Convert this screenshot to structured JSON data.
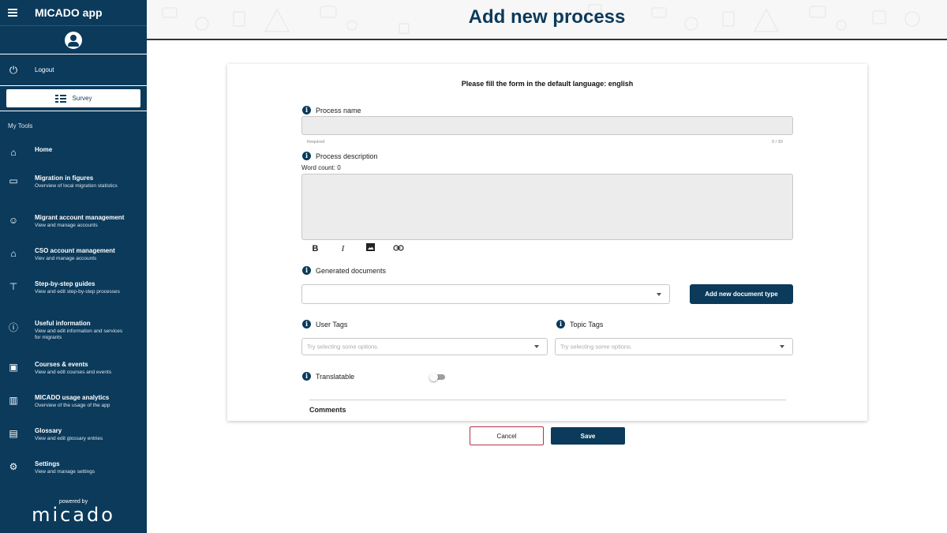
{
  "app": {
    "title": "MICADO app"
  },
  "sidebar": {
    "logout_label": "Logout",
    "survey_label": "Survey",
    "section_title": "My Tools",
    "items": [
      {
        "icon": "home-icon",
        "glyph": "⌂",
        "title": "Home",
        "subtitle": ""
      },
      {
        "icon": "figures-icon",
        "glyph": "▭",
        "title": "Migration in figures",
        "subtitle": "Overview of local migration statistics"
      },
      {
        "icon": "account-icon",
        "glyph": "☺",
        "title": "Migrant account management",
        "subtitle": "View and manage accounts"
      },
      {
        "icon": "institution-icon",
        "glyph": "⌂",
        "title": "CSO account management",
        "subtitle": "Viev and manage accounts"
      },
      {
        "icon": "guide-icon",
        "glyph": "⊤",
        "title": "Step-by-step guides",
        "subtitle": "View and edit step-by-step processes"
      },
      {
        "icon": "info-icon",
        "glyph": "ⓘ",
        "title": "Useful information",
        "subtitle": "View and edit information and services for migrants"
      },
      {
        "icon": "calendar-icon",
        "glyph": "▣",
        "title": "Courses & events",
        "subtitle": "View and edit courses and events"
      },
      {
        "icon": "analytics-icon",
        "glyph": "▥",
        "title": "MICADO usage analytics",
        "subtitle": "Overview of the usage of the app"
      },
      {
        "icon": "glossary-icon",
        "glyph": "▤",
        "title": "Glossary",
        "subtitle": "View and edit glossary entries"
      },
      {
        "icon": "settings-icon",
        "glyph": "⚙",
        "title": "Settings",
        "subtitle": "View and manage settings"
      }
    ],
    "powered_by": "powered by",
    "logo_text": "micado"
  },
  "header": {
    "title": "Add new process"
  },
  "form": {
    "instruction": "Please fill the form in the default language: english",
    "process_name_label": "Process name",
    "process_name_value": "",
    "required_hint": "Required",
    "char_counter": "0 / 30",
    "description_label": "Process description",
    "word_count": "Word count: 0",
    "editor_toolbar": [
      "B",
      "I",
      "image",
      "link"
    ],
    "generated_docs_label": "Generated documents",
    "add_doc_type_button": "Add new document type",
    "user_tags_label": "User Tags",
    "user_tags_placeholder": "Try selecting some options.",
    "topic_tags_label": "Topic Tags",
    "topic_tags_placeholder": "Try selecting some options.",
    "translatable_label": "Translatable",
    "translatable_on": false,
    "comments_label": "Comments"
  },
  "actions": {
    "cancel": "Cancel",
    "save": "Save"
  },
  "colors": {
    "primary": "#0b3a5b",
    "cancel_border": "#b0344d",
    "input_bg": "#ececec"
  }
}
